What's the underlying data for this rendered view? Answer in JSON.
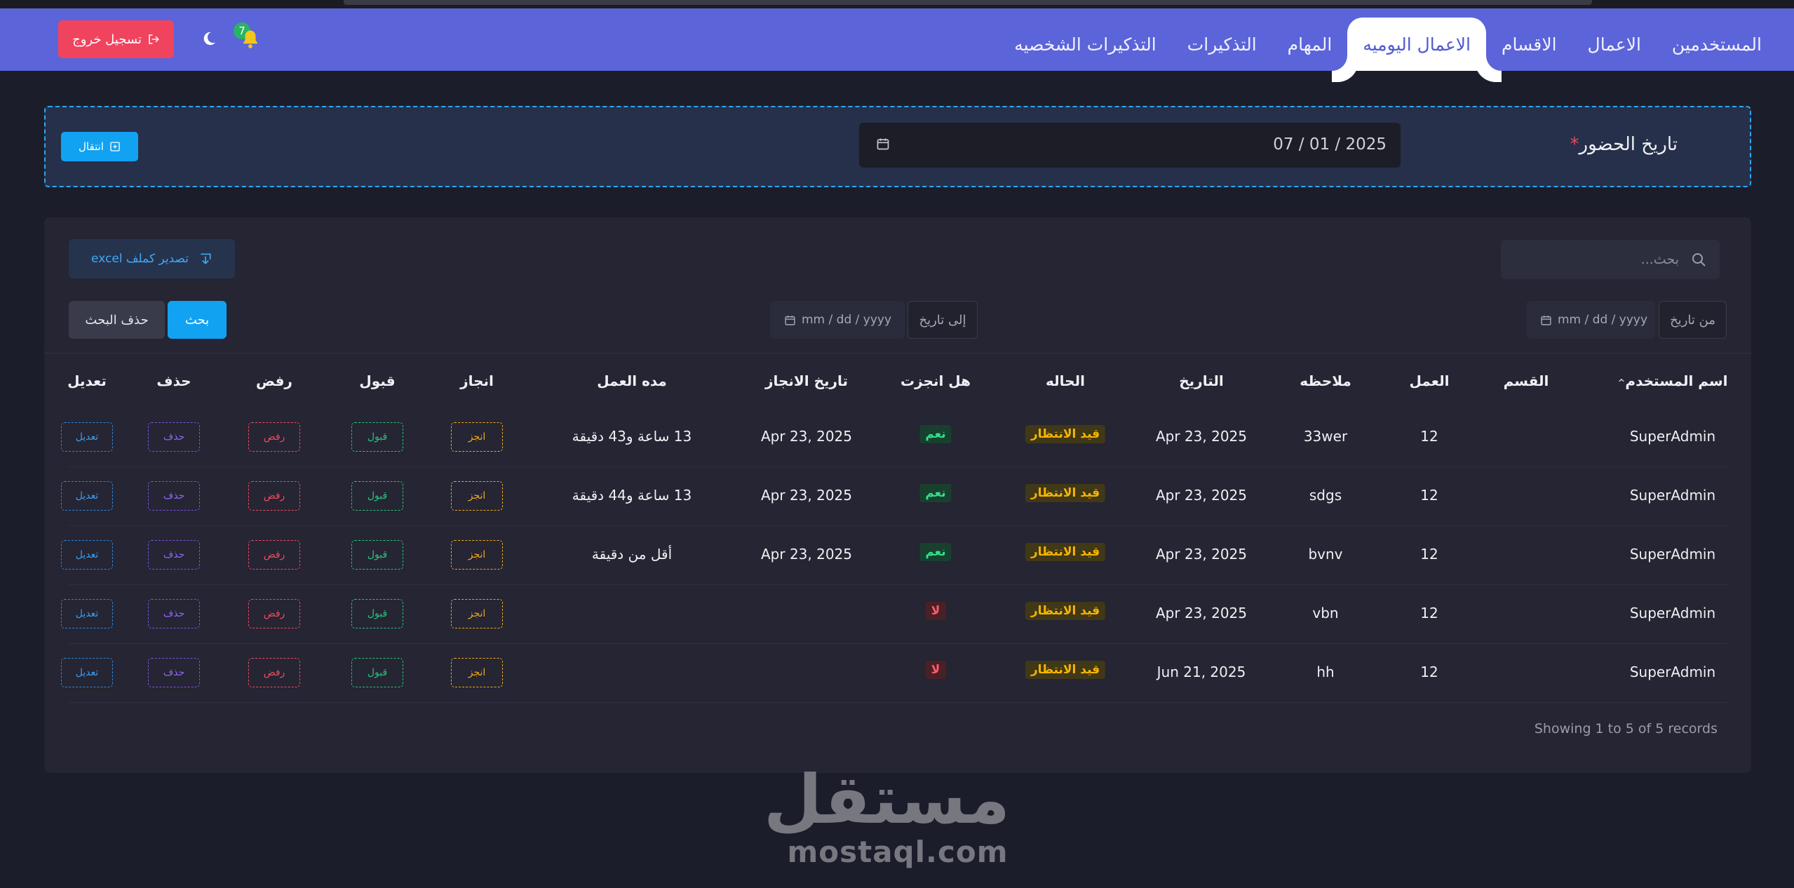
{
  "nav": {
    "tabs": [
      {
        "label": "المستخدمين",
        "active": false
      },
      {
        "label": "الاعمال",
        "active": false
      },
      {
        "label": "الاقسام",
        "active": false
      },
      {
        "label": "الاعمال اليوميه",
        "active": true
      },
      {
        "label": "المهام",
        "active": false
      },
      {
        "label": "التذكيرات",
        "active": false
      },
      {
        "label": "التذكيرات الشخصيه",
        "active": false
      }
    ],
    "logout_label": "تسجيل خروج",
    "notification_count": "7",
    "colors": {
      "navbar": "#5b64d8",
      "logout": "#f0435e"
    }
  },
  "attendance": {
    "label": "تاريخ الحضور",
    "required_mark": "*",
    "date_value": "07 / 01 / 2025",
    "move_label": "انتقال"
  },
  "toolbar": {
    "search_placeholder": "بحث...",
    "export_label": "تصدير كملف excel",
    "from_label": "من تاريخ",
    "to_label": "إلى تاريخ",
    "from_placeholder": "mm / dd / yyyy",
    "to_placeholder": "mm / dd / yyyy",
    "search_label": "بحث",
    "clear_label": "حذف البحث"
  },
  "table": {
    "headers": {
      "user": "اسم المستخدم",
      "department": "القسم",
      "work": "العمل",
      "note": "ملاحظه",
      "date": "التاريخ",
      "status": "الحاله",
      "is_done": "هل انجزت",
      "done_date": "تاريخ الانجاز",
      "duration": "مده العمل",
      "done": "انجاز",
      "accept": "قبول",
      "reject": "رفض",
      "delete": "حذف",
      "edit": "تعديل"
    },
    "action_labels": {
      "done": "انجز",
      "accept": "قبول",
      "reject": "رفض",
      "delete": "حذف",
      "edit": "تعديل"
    },
    "rows": [
      {
        "user": "SuperAdmin",
        "department": "",
        "work": "12",
        "note": "33wer",
        "date": "Apr 23, 2025",
        "status": "قيد الانتظار",
        "is_done": "نعم",
        "is_done_flag": true,
        "done_date": "Apr 23, 2025",
        "duration": "13 ساعة و43 دقيقة"
      },
      {
        "user": "SuperAdmin",
        "department": "",
        "work": "12",
        "note": "sdgs",
        "date": "Apr 23, 2025",
        "status": "قيد الانتظار",
        "is_done": "نعم",
        "is_done_flag": true,
        "done_date": "Apr 23, 2025",
        "duration": "13 ساعة و44 دقيقة"
      },
      {
        "user": "SuperAdmin",
        "department": "",
        "work": "12",
        "note": "bvnv",
        "date": "Apr 23, 2025",
        "status": "قيد الانتظار",
        "is_done": "نعم",
        "is_done_flag": true,
        "done_date": "Apr 23, 2025",
        "duration": "أقل من دقيقة"
      },
      {
        "user": "SuperAdmin",
        "department": "",
        "work": "12",
        "note": "vbn",
        "date": "Apr 23, 2025",
        "status": "قيد الانتظار",
        "is_done": "لا",
        "is_done_flag": false,
        "done_date": "",
        "duration": ""
      },
      {
        "user": "SuperAdmin",
        "department": "",
        "work": "12",
        "note": "hh",
        "date": "Jun 21, 2025",
        "status": "قيد الانتظار",
        "is_done": "لا",
        "is_done_flag": false,
        "done_date": "",
        "duration": ""
      }
    ],
    "records_text": "Showing 1 to 5 of 5 records"
  },
  "watermark": {
    "arabic": "مستقل",
    "latin": "mostaql.com"
  }
}
